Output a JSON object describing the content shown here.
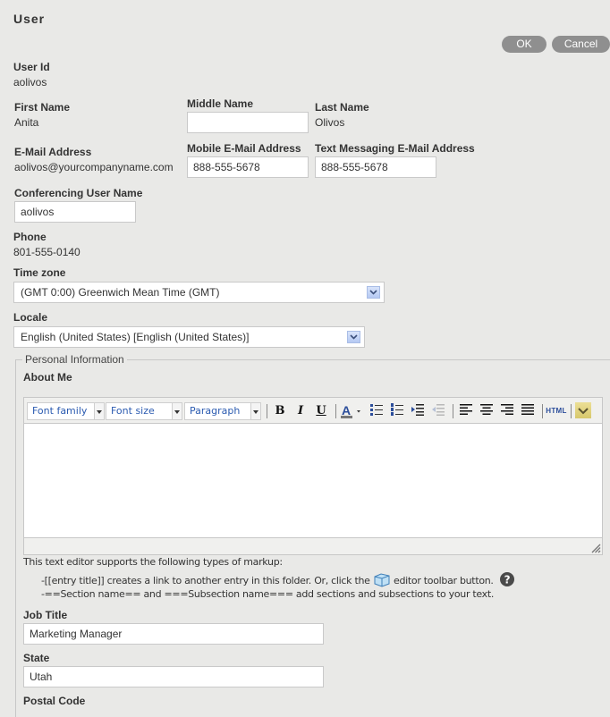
{
  "page": {
    "title": "User",
    "ok_label": "OK",
    "cancel_label": "Cancel"
  },
  "fields": {
    "user_id": {
      "label": "User Id",
      "value": "aolivos"
    },
    "first_name": {
      "label": "First Name",
      "value": "Anita"
    },
    "middle_name": {
      "label": "Middle Name",
      "value": ""
    },
    "last_name": {
      "label": "Last Name",
      "value": "Olivos"
    },
    "email": {
      "label": "E-Mail Address",
      "value": "aolivos@yourcompanyname.com"
    },
    "mobile_email": {
      "label": "Mobile E-Mail Address",
      "value": "888-555-5678"
    },
    "text_email": {
      "label": "Text Messaging E-Mail Address",
      "value": "888-555-5678"
    },
    "conf_user": {
      "label": "Conferencing User Name",
      "value": "aolivos"
    },
    "phone": {
      "label": "Phone",
      "value": "801-555-0140"
    },
    "timezone": {
      "label": "Time zone",
      "value": "(GMT 0:00) Greenwich Mean Time (GMT)"
    },
    "locale": {
      "label": "Locale",
      "value": "English (United States) [English (United States)]"
    }
  },
  "personal": {
    "legend": "Personal Information",
    "about_me_label": "About Me",
    "editor": {
      "font_family": "Font family",
      "font_size": "Font size",
      "block_format": "Paragraph",
      "bold": "B",
      "italic": "I",
      "underline": "U",
      "html": "HTML",
      "content": ""
    },
    "help": {
      "intro": "This text editor supports the following types of markup:",
      "line1_a": "-[[entry title]] creates a link to another entry in this folder. Or, click the",
      "line1_b": "editor toolbar button.",
      "line2": "-==Section name== and ===Subsection name=== add sections and subsections to your text."
    },
    "job_title": {
      "label": "Job Title",
      "value": "Marketing Manager"
    },
    "state": {
      "label": "State",
      "value": "Utah"
    },
    "postal_code": {
      "label": "Postal Code"
    }
  }
}
